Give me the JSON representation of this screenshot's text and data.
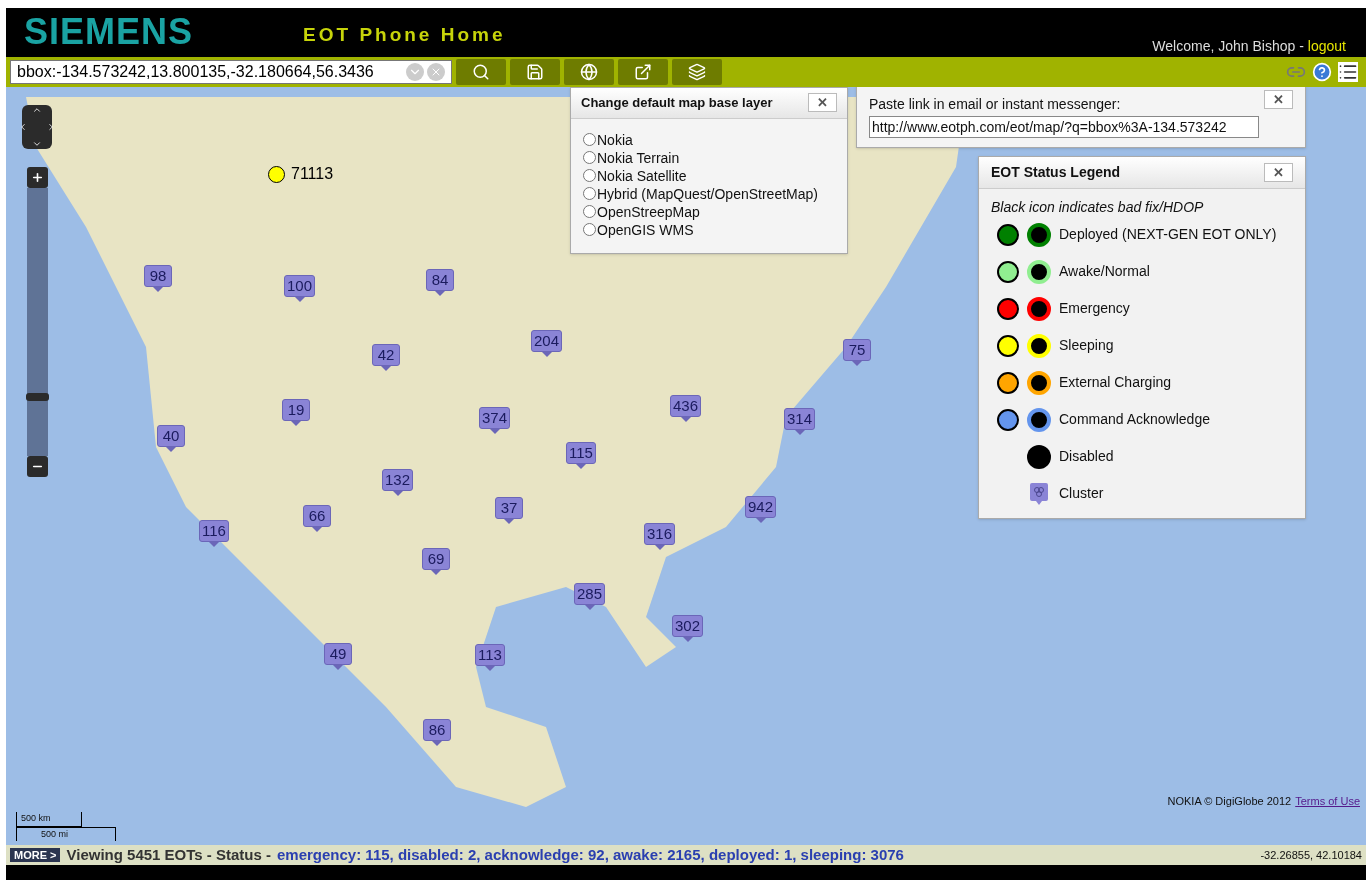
{
  "header": {
    "logo": "SIEMENS",
    "title": "EOT Phone Home",
    "welcome": "Welcome, John Bishop -",
    "logout": "logout"
  },
  "toolbar": {
    "search_value": "bbox:-134.573242,13.800135,-32.180664,56.3436"
  },
  "base_layer_popup": {
    "title": "Change default map base layer",
    "close": "✕",
    "options": [
      {
        "label": "Nokia",
        "selected": false
      },
      {
        "label": "Nokia Terrain",
        "selected": false
      },
      {
        "label": "Nokia Satellite",
        "selected": false
      },
      {
        "label": "Hybrid (MapQuest/OpenStreetMap)",
        "selected": false
      },
      {
        "label": "OpenStreepMap",
        "selected": false
      },
      {
        "label": "OpenGIS WMS",
        "selected": false
      }
    ]
  },
  "link_popup": {
    "label": "Paste link in email or instant messenger:",
    "value": "http://www.eotph.com/eot/map/?q=bbox%3A-134.573242",
    "close": "✕"
  },
  "legend": {
    "title": "EOT Status Legend",
    "close": "✕",
    "note": "Black icon indicates bad fix/HDOP",
    "items": [
      {
        "kind": "pair",
        "color": "#008000",
        "label": "Deployed (NEXT-GEN EOT ONLY)"
      },
      {
        "kind": "pair",
        "color": "#90ee90",
        "label": "Awake/Normal"
      },
      {
        "kind": "pair",
        "color": "#ff0000",
        "label": "Emergency"
      },
      {
        "kind": "pair",
        "color": "#ffff00",
        "label": "Sleeping"
      },
      {
        "kind": "pair",
        "color": "#ffa500",
        "label": "External Charging"
      },
      {
        "kind": "pair",
        "color": "#6495ed",
        "label": "Command Acknowledge"
      },
      {
        "kind": "single",
        "color": "#000000",
        "label": "Disabled"
      },
      {
        "kind": "cluster",
        "label": "Cluster"
      }
    ]
  },
  "map": {
    "point": {
      "label": "71113",
      "color": "#ffff00"
    },
    "clusters": [
      "98",
      "100",
      "84",
      "204",
      "42",
      "75",
      "19",
      "374",
      "436",
      "314",
      "40",
      "115",
      "132",
      "942",
      "66",
      "37",
      "116",
      "316",
      "69",
      "285",
      "302",
      "49",
      "113",
      "86"
    ],
    "zoom": {
      "level": 0.22
    },
    "attribution": "NOKIA © DigiGlobe 2012",
    "terms": "Terms of Use",
    "scale_km": "500 km",
    "scale_mi": "500 mi"
  },
  "status_bar": {
    "more": "MORE >",
    "viewing": "Viewing 5451 EOTs - Status -",
    "counts": "emergency: 115, disabled: 2, acknowledge: 92, awake: 2165, deployed: 1, sleeping: 3076",
    "coords": "-32.26855, 42.10184"
  }
}
